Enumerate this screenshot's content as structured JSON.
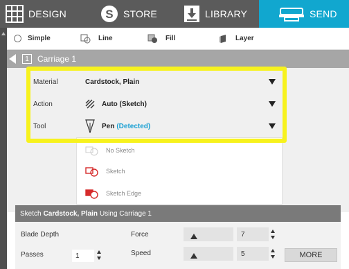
{
  "nav": {
    "design": "DESIGN",
    "store": "STORE",
    "library": "LIBRARY",
    "send": "SEND",
    "active_color": "#11a7cf",
    "bar_color": "#5b5b5b"
  },
  "modes": {
    "simple": "Simple",
    "line": "Line",
    "fill": "Fill",
    "layer": "Layer"
  },
  "carriage": {
    "number": "1",
    "label": "Carriage 1"
  },
  "settings": {
    "material_label": "Material",
    "material_value": "Cardstock, Plain",
    "action_label": "Action",
    "action_value": "Auto (Sketch)",
    "tool_label": "Tool",
    "tool_value": "Pen",
    "tool_detected": "(Detected)",
    "highlight_color": "#f7f21d"
  },
  "dropdown": {
    "options": [
      "No Sketch",
      "Sketch",
      "Sketch Edge"
    ]
  },
  "summary": {
    "prefix": "Sketch",
    "material": "Cardstock, Plain",
    "suffix": "Using Carriage 1"
  },
  "bottom": {
    "blade_depth_label": "Blade Depth",
    "force_label": "Force",
    "force_value": "7",
    "passes_label": "Passes",
    "passes_value": "1",
    "speed_label": "Speed",
    "speed_value": "5",
    "more_label": "MORE"
  }
}
